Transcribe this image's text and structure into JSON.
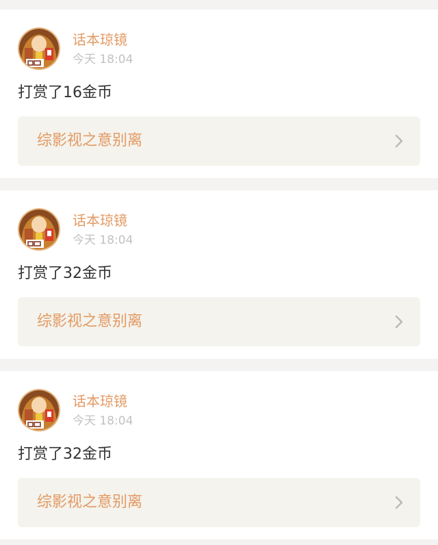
{
  "feed": {
    "items": [
      {
        "username": "话本琼镜",
        "time": "今天 18:04",
        "message": "打赏了16金币",
        "book_title": "综影视之意别离",
        "avatar_icon": "user-avatar-icon",
        "link_icon": "chevron-right-icon"
      },
      {
        "username": "话本琼镜",
        "time": "今天 18:04",
        "message": "打赏了32金币",
        "book_title": "综影视之意别离",
        "avatar_icon": "user-avatar-icon",
        "link_icon": "chevron-right-icon"
      },
      {
        "username": "话本琼镜",
        "time": "今天 18:04",
        "message": "打赏了32金币",
        "book_title": "综影视之意别离",
        "avatar_icon": "user-avatar-icon",
        "link_icon": "chevron-right-icon"
      }
    ]
  },
  "colors": {
    "page_background": "#f4f3f2",
    "card_background": "#ffffff",
    "accent": "#e39a64",
    "timestamp": "#c2c2c2",
    "message_text": "#333333",
    "link_background": "#f4f3ed",
    "chevron": "#b9b9b9"
  }
}
